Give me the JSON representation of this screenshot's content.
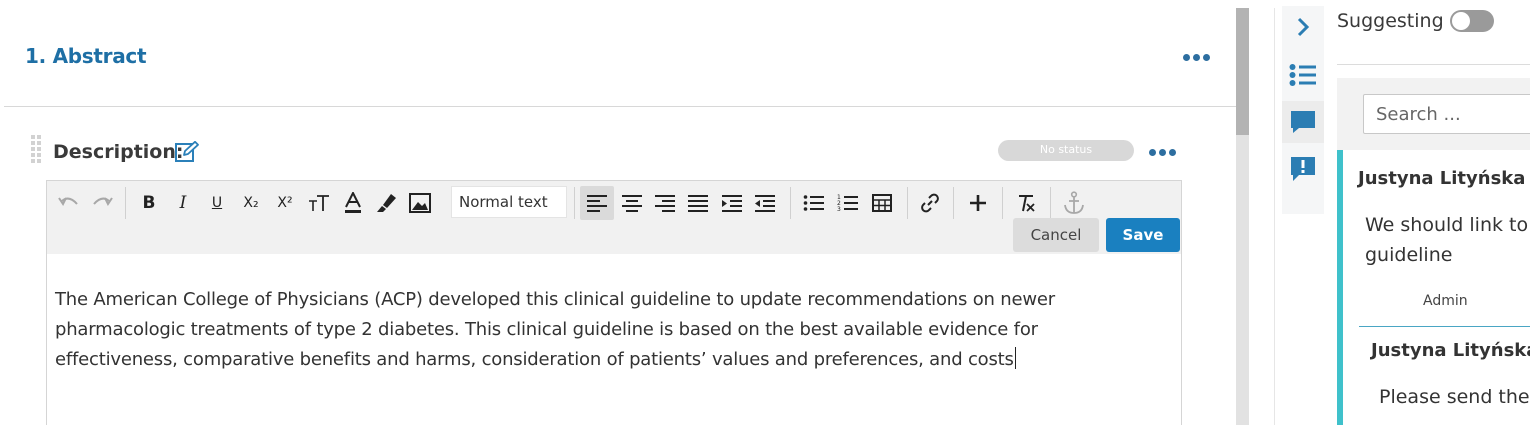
{
  "section": {
    "title": "1. Abstract"
  },
  "description": {
    "label": "Description:",
    "status": "No status"
  },
  "toolbar": {
    "undo_icon": "undo-icon",
    "redo_icon": "redo-icon",
    "bold": "B",
    "italic": "I",
    "underline": "U",
    "subscript": "X₂",
    "superscript": "X²",
    "text_size": "TT",
    "paragraph_style": "Normal text",
    "cancel_label": "Cancel",
    "save_label": "Save"
  },
  "editor": {
    "lines": [
      "The American College of Physicians (ACP) developed this clinical guideline to update recommendations on newer",
      "pharmacologic treatments of type 2 diabetes. This clinical guideline is based on the best available evidence for",
      "effectiveness, comparative benefits and harms, consideration of patients’ values and preferences, and costs"
    ]
  },
  "panel": {
    "suggesting_label": "Suggesting",
    "suggesting_on": false,
    "search_placeholder": "Search ...",
    "comments": [
      {
        "author": "Justyna Lityńska",
        "text_lines": [
          "We should link to",
          "guideline"
        ],
        "role": "Admin"
      },
      {
        "author": "Justyna Lityńska",
        "text_lines": [
          "Please send the"
        ]
      }
    ]
  },
  "colors": {
    "accent": "#1e6fa5",
    "save": "#1a80c0",
    "comment_bar": "#3fc1cb"
  }
}
